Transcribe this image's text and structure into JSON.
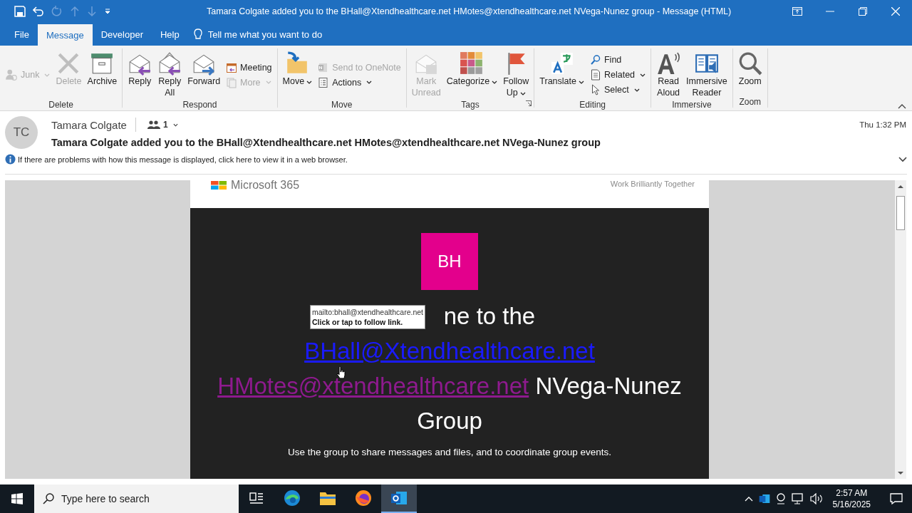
{
  "window": {
    "title": "Tamara Colgate added you to the BHall@Xtendhealthcare.net HMotes@xtendhealthcare.net NVega-Nunez group  -  Message (HTML)"
  },
  "tabs": [
    {
      "label": "File",
      "selected": false
    },
    {
      "label": "Message",
      "selected": true
    },
    {
      "label": "Developer",
      "selected": false
    },
    {
      "label": "Help",
      "selected": false
    }
  ],
  "tell_me": {
    "placeholder": "Tell me what you want to do"
  },
  "ribbon": {
    "groups": [
      {
        "label": "Delete",
        "launcher": false,
        "items": [
          {
            "kind": "small",
            "label": "Junk",
            "disabled": true,
            "dropdown": true
          },
          {
            "kind": "large",
            "label": "Delete",
            "disabled": true,
            "dropdown": false
          },
          {
            "kind": "large",
            "label": "Archive",
            "disabled": false,
            "dropdown": false
          }
        ]
      },
      {
        "label": "Respond",
        "launcher": false,
        "items": [
          {
            "kind": "large",
            "label": "Reply",
            "disabled": false,
            "dropdown": false
          },
          {
            "kind": "large",
            "label": "Reply\nAll",
            "disabled": false,
            "dropdown": false
          },
          {
            "kind": "large",
            "label": "Forward",
            "disabled": false,
            "dropdown": false
          },
          {
            "kind": "small",
            "label": "Meeting",
            "disabled": false,
            "dropdown": false
          },
          {
            "kind": "small",
            "label": "More",
            "disabled": true,
            "dropdown": true
          }
        ]
      },
      {
        "label": "Move",
        "launcher": false,
        "items": [
          {
            "kind": "large",
            "label": "Move",
            "disabled": false,
            "dropdown": true
          },
          {
            "kind": "small",
            "label": "Send to OneNote",
            "disabled": true,
            "dropdown": false
          },
          {
            "kind": "small",
            "label": "Actions",
            "disabled": false,
            "dropdown": true
          }
        ]
      },
      {
        "label": "Tags",
        "launcher": true,
        "items": [
          {
            "kind": "large",
            "label": "Mark\nUnread",
            "disabled": true,
            "dropdown": false
          },
          {
            "kind": "large",
            "label": "Categorize",
            "disabled": false,
            "dropdown": true
          },
          {
            "kind": "large",
            "label": "Follow\nUp",
            "disabled": false,
            "dropdown": true
          }
        ]
      },
      {
        "label": "Editing",
        "launcher": false,
        "items": [
          {
            "kind": "large",
            "label": "Translate",
            "disabled": false,
            "dropdown": true
          },
          {
            "kind": "small",
            "label": "Find",
            "disabled": false,
            "dropdown": false
          },
          {
            "kind": "small",
            "label": "Related",
            "disabled": false,
            "dropdown": true
          },
          {
            "kind": "small",
            "label": "Select",
            "disabled": false,
            "dropdown": true
          }
        ]
      },
      {
        "label": "Immersive",
        "launcher": false,
        "items": [
          {
            "kind": "large",
            "label": "Read\nAloud",
            "disabled": false,
            "dropdown": false
          },
          {
            "kind": "large",
            "label": "Immersive\nReader",
            "disabled": false,
            "dropdown": false
          }
        ]
      },
      {
        "label": "Zoom",
        "launcher": false,
        "items": [
          {
            "kind": "large",
            "label": "Zoom",
            "disabled": false,
            "dropdown": false
          }
        ]
      }
    ]
  },
  "message": {
    "avatar": "TC",
    "sender": "Tamara Colgate",
    "recipients": "1",
    "date": "Thu 1:32 PM",
    "subject": "Tamara Colgate added you to the BHall@Xtendhealthcare.net HMotes@xtendhealthcare.net NVega-Nunez group",
    "info": "If there are problems with how this message is displayed, click here to view it in a web browser."
  },
  "email": {
    "brand": "Microsoft 365",
    "tagline": "Work Brilliantly Together",
    "badge": "BH",
    "heading": {
      "text_before": "ne to the",
      "link_1": "BHall@Xtendhealthcare.net",
      "link_2": "HMotes@xtendhealthcare.net",
      "text_after": "NVega-Nunez",
      "last_line": "Group"
    },
    "description": "Use the group to share messages and files, and to coordinate group events.",
    "tooltip": {
      "url": "mailto:bhall@xtendhealthcare.net",
      "hint": "Click or tap to follow link."
    }
  },
  "taskbar": {
    "search": {
      "placeholder": "Type here to search"
    },
    "apps": [
      {
        "selected": false
      },
      {
        "selected": false
      },
      {
        "selected": false
      },
      {
        "selected": false
      },
      {
        "selected": true
      }
    ],
    "time": "2:57 AM",
    "date": "5/16/2025"
  }
}
